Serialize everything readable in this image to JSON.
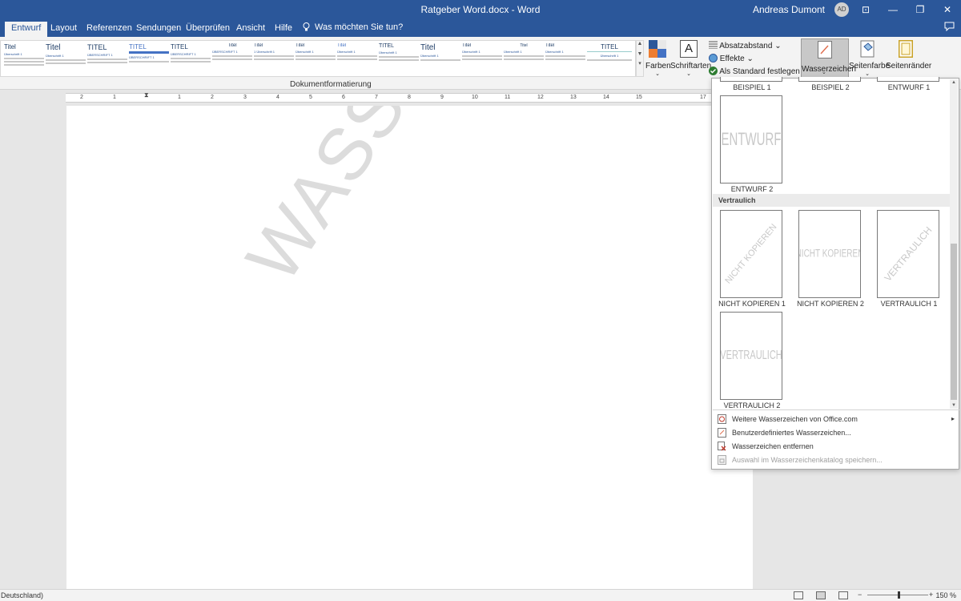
{
  "window": {
    "title": "Ratgeber Word.docx  -  Word",
    "user_name": "Andreas Dumont",
    "user_initials": "AD",
    "minimize_glyph": "—",
    "restore_glyph": "❐",
    "close_glyph": "✕",
    "ribbon_display_glyph": "⊡"
  },
  "tabs": [
    {
      "label": "Entwurf",
      "active": true
    },
    {
      "label": "Layout"
    },
    {
      "label": "Referenzen"
    },
    {
      "label": "Sendungen"
    },
    {
      "label": "Überprüfen"
    },
    {
      "label": "Ansicht"
    },
    {
      "label": "Hilfe"
    }
  ],
  "tell_me": "Was möchten Sie tun?",
  "ribbon": {
    "style_gallery": [
      {
        "title": "Titel",
        "heading": "Überschrift 1"
      },
      {
        "title": "Titel",
        "heading": "Überschrift 1"
      },
      {
        "title": "TITEL",
        "heading": "ÜBERSCHRIFT 1"
      },
      {
        "title": "TITEL",
        "heading": "ÜBERSCHRIFT 1"
      },
      {
        "title": "TITEL",
        "heading": "ÜBERSCHRIFT 1"
      },
      {
        "title": "Titel",
        "heading": "ÜBERSCHRIFT 1"
      },
      {
        "title": "Titel",
        "heading": "1 Überschrift 1"
      },
      {
        "title": "Titel",
        "heading": "Überschrift 1"
      },
      {
        "title": "Titel",
        "heading": "Überschrift 1"
      },
      {
        "title": "TITEL",
        "heading": "Überschrift 1"
      },
      {
        "title": "Titel",
        "heading": "Überschrift 1"
      },
      {
        "title": "Titel",
        "heading": "Überschrift 1"
      },
      {
        "title": "Titel",
        "heading": "Überschrift 1"
      },
      {
        "title": "Titel",
        "heading": "Überschrift 1"
      },
      {
        "title": "TITEL",
        "heading": "Überschrift 1"
      }
    ],
    "group_label": "Dokumentformatierung",
    "colors_label": "Farben",
    "fonts_label": "Schriftarten",
    "paragraph_spacing_label": "Absatzabstand",
    "effects_label": "Effekte",
    "set_default_label": "Als Standard festlegen",
    "watermark_label": "Wasserzeichen",
    "page_color_label": "Seitenfarbe",
    "page_borders_label": "Seitenränder",
    "accent_color": "#2b579a"
  },
  "ruler": {
    "marks": [
      "2",
      "1",
      "1",
      "2",
      "3",
      "4",
      "5",
      "6",
      "7",
      "8",
      "9",
      "10",
      "11",
      "12",
      "13",
      "14",
      "15",
      "17"
    ]
  },
  "document": {
    "watermark_text": "WASSERZEICHEN"
  },
  "watermark_menu": {
    "top_row_labels": [
      "BEISPIEL 1",
      "BEISPIEL 2",
      "ENTWURF 1"
    ],
    "entwurf2": {
      "label": "ENTWURF 2",
      "text": "ENTWURF"
    },
    "section_confidential": "Vertraulich",
    "confidential_items": [
      {
        "label": "NICHT KOPIEREN 1",
        "text": "NICHT KOPIEREN"
      },
      {
        "label": "NICHT KOPIEREN 2",
        "text": "NICHT KOPIEREN"
      },
      {
        "label": "VERTRAULICH 1",
        "text": "VERTRAULICH"
      },
      {
        "label": "VERTRAULICH 2",
        "text": "VERTRAULICH"
      }
    ],
    "commands": [
      {
        "label": "Weitere Wasserzeichen von Office.com",
        "icon": "office-watermark-icon",
        "has_submenu": true
      },
      {
        "label": "Benutzerdefiniertes Wasserzeichen...",
        "icon": "custom-watermark-icon"
      },
      {
        "label": "Wasserzeichen entfernen",
        "icon": "remove-watermark-icon"
      },
      {
        "label": "Auswahl im Wasserzeichenkatalog speichern...",
        "icon": "save-selection-icon",
        "disabled": true
      }
    ]
  },
  "status": {
    "language": "Deutschland)",
    "zoom": "150 %",
    "zoom_minus": "−",
    "zoom_plus": "+"
  }
}
